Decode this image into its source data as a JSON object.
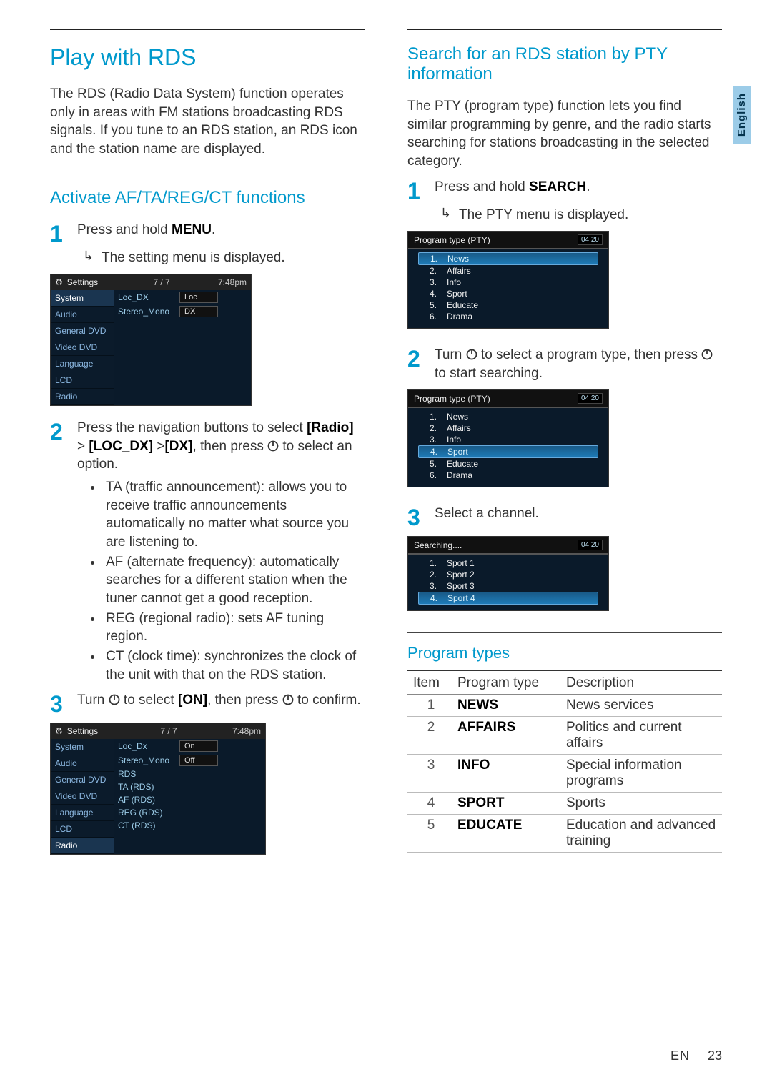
{
  "side_label": "English",
  "footer": {
    "lang": "EN",
    "page": "23"
  },
  "left": {
    "h1": "Play with RDS",
    "intro": "The RDS (Radio Data System) function operates only in areas with FM stations broadcasting RDS signals. If you tune to an RDS station, an RDS icon and the station name are displayed.",
    "h2": "Activate AF/TA/REG/CT functions",
    "step1_a": "Press and hold ",
    "step1_b": "MENU",
    "step1_c": ".",
    "step1_result": "The setting menu is displayed.",
    "step2_a": "Press the navigation buttons to select ",
    "step2_b": "[Radio]",
    "step2_c": " > ",
    "step2_d": "[LOC_DX]",
    "step2_e": " >",
    "step2_f": "[DX]",
    "step2_g": ", then press ",
    "step2_h": " to select an option.",
    "bullets": [
      "TA (traffic announcement): allows you to receive traffic announcements automatically no matter what source you are listening to.",
      "AF (alternate frequency): automatically searches for a different station when the tuner cannot get a good reception.",
      "REG (regional radio): sets AF tuning region.",
      "CT (clock time): synchronizes the clock of the unit with that on the RDS station."
    ],
    "step3_a": "Turn ",
    "step3_b": " to select ",
    "step3_c": "[ON]",
    "step3_d": ", then press ",
    "step3_e": " to confirm.",
    "mock1": {
      "title": "Settings",
      "mid": "7 / 7",
      "time": "7:48pm",
      "side": [
        "System",
        "Audio",
        "General DVD",
        "Video DVD",
        "Language",
        "LCD",
        "Radio"
      ],
      "row1_lbl": "Loc_DX",
      "row1_val": "Loc",
      "row2_lbl": "Stereo_Mono",
      "row2_val": "DX"
    },
    "mock2": {
      "title": "Settings",
      "mid": "7 / 7",
      "time": "7:48pm",
      "side": [
        "System",
        "Audio",
        "General DVD",
        "Video DVD",
        "Language",
        "LCD",
        "Radio"
      ],
      "rows": [
        {
          "lbl": "Loc_Dx",
          "val": "On"
        },
        {
          "lbl": "Stereo_Mono",
          "val": "Off"
        },
        {
          "lbl": "RDS",
          "val": ""
        },
        {
          "lbl": "TA (RDS)",
          "val": ""
        },
        {
          "lbl": "AF (RDS)",
          "val": ""
        },
        {
          "lbl": "REG (RDS)",
          "val": ""
        },
        {
          "lbl": "CT (RDS)",
          "val": ""
        }
      ]
    }
  },
  "right": {
    "h2": "Search for an RDS station by PTY information",
    "intro": "The PTY (program type) function lets you find similar programming by genre, and the radio starts searching for stations broadcasting in the selected category.",
    "step1_a": "Press and hold ",
    "step1_b": "SEARCH",
    "step1_c": ".",
    "step1_result": "The PTY menu is displayed.",
    "mock_pty_title": "Program type (PTY)",
    "mock_time": "04:20",
    "pty1": {
      "selected": 0,
      "items": [
        "News",
        "Affairs",
        "Info",
        "Sport",
        "Educate",
        "Drama"
      ]
    },
    "step2_a": "Turn ",
    "step2_b": " to select a program type, then press ",
    "step2_c": " to start searching.",
    "pty2": {
      "selected": 3,
      "items": [
        "News",
        "Affairs",
        "Info",
        "Sport",
        "Educate",
        "Drama"
      ]
    },
    "step3": "Select a channel.",
    "search_title": "Searching....",
    "search": {
      "selected": 3,
      "items": [
        "Sport 1",
        "Sport 2",
        "Sport 3",
        "Sport 4"
      ]
    },
    "pt_h3": "Program types",
    "pt_head": {
      "c1": "Item",
      "c2": "Program type",
      "c3": "Description"
    },
    "pt_rows": [
      {
        "n": "1",
        "pt": "NEWS",
        "desc": "News services"
      },
      {
        "n": "2",
        "pt": "AFFAIRS",
        "desc": "Politics and current affairs"
      },
      {
        "n": "3",
        "pt": "INFO",
        "desc": "Special information programs"
      },
      {
        "n": "4",
        "pt": "SPORT",
        "desc": "Sports"
      },
      {
        "n": "5",
        "pt": "EDUCATE",
        "desc": "Education and advanced training"
      }
    ]
  }
}
